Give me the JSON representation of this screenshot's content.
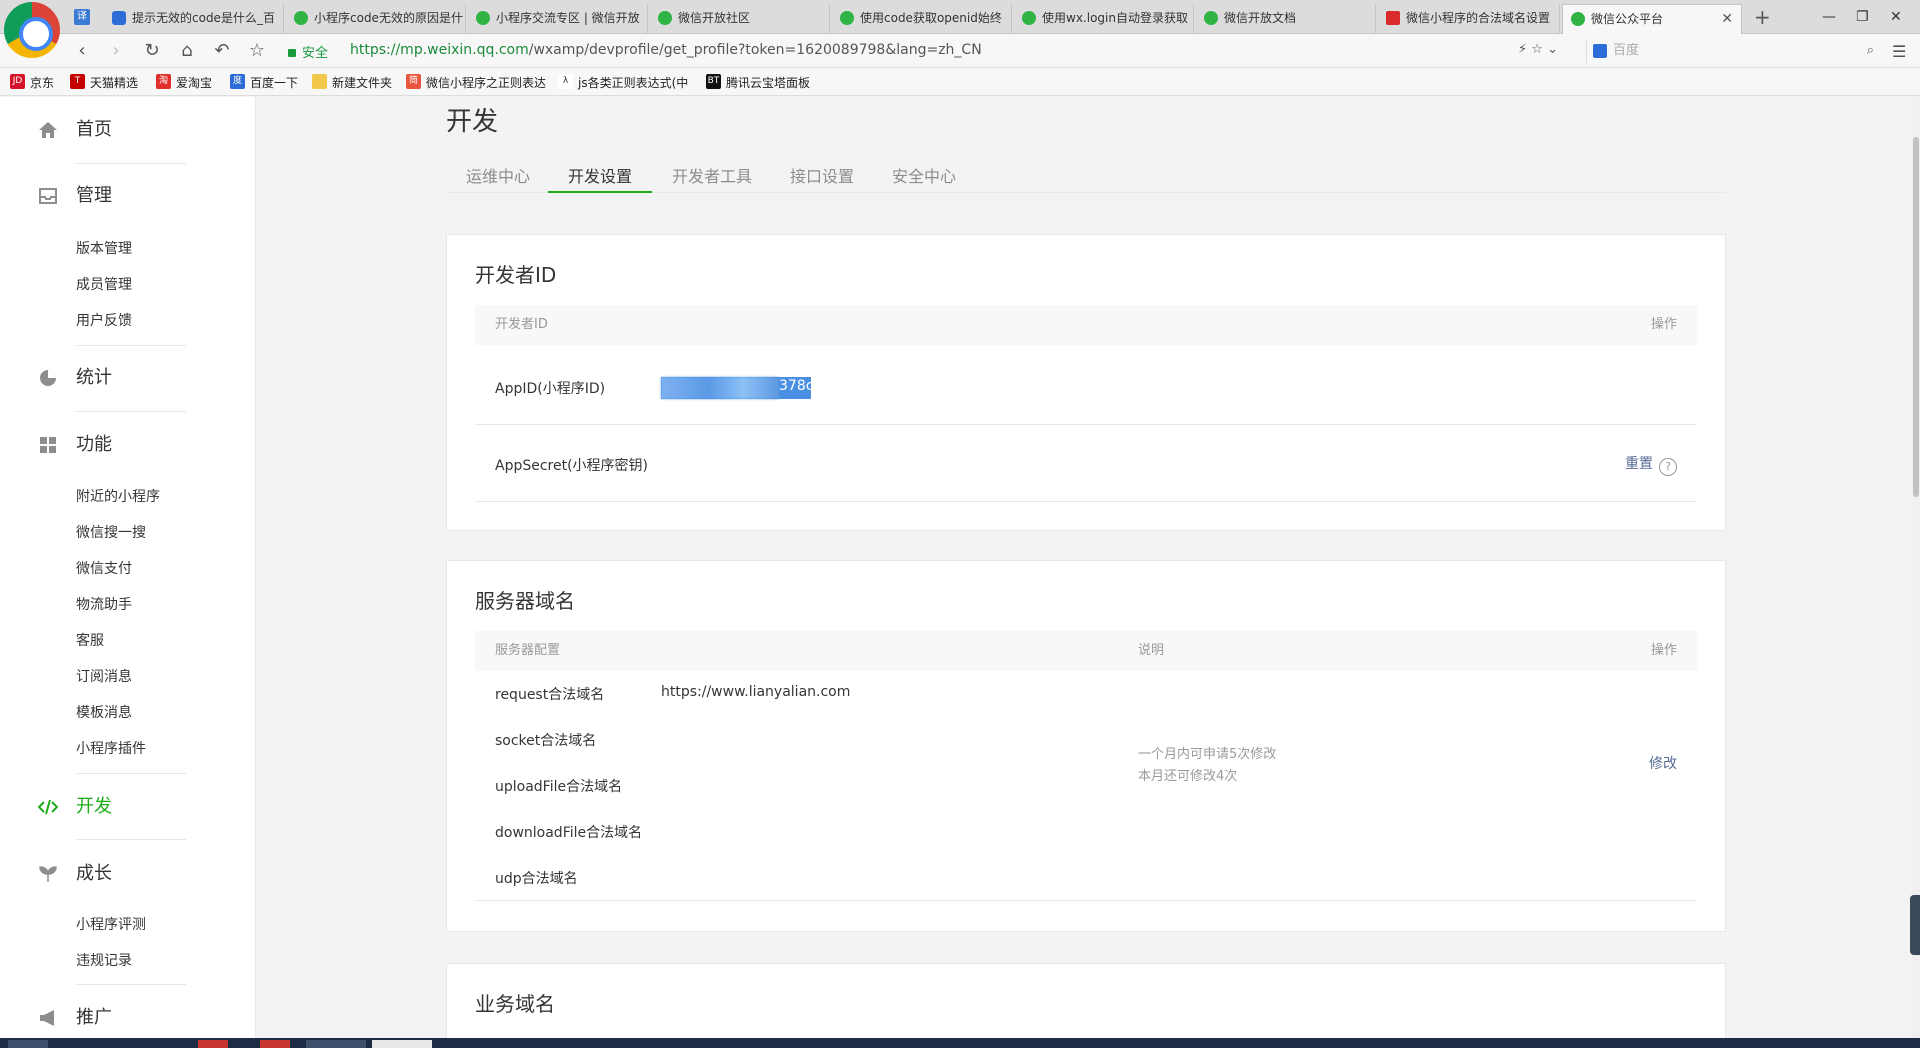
{
  "browser": {
    "tabs": [
      {
        "label": "提示无效的code是什么_百"
      },
      {
        "label": "小程序code无效的原因是什"
      },
      {
        "label": "小程序交流专区 | 微信开放"
      },
      {
        "label": "微信开放社区"
      },
      {
        "label": "使用code获取openid始终"
      },
      {
        "label": "使用wx.login自动登录获取"
      },
      {
        "label": "微信开放文档"
      },
      {
        "label": "微信小程序的合法域名设置"
      },
      {
        "label": "微信公众平台"
      }
    ],
    "pin_label": "译",
    "secure_label": "安全",
    "url_host": "https://mp.weixin.qq.com",
    "url_path": "/wxamp/devprofile/get_profile?token=1620089798&lang=zh_CN",
    "search_placeholder": "百度",
    "bookmarks": [
      {
        "label": "京东",
        "icon": "JD",
        "color": "#d4142a"
      },
      {
        "label": "天猫精选",
        "icon": "T",
        "color": "#c40000"
      },
      {
        "label": "爱淘宝",
        "icon": "淘",
        "color": "#e0302c"
      },
      {
        "label": "百度一下",
        "icon": "度",
        "color": "#2d6bd6"
      },
      {
        "label": "新建文件夹",
        "icon": "",
        "color": "#f2c94c"
      },
      {
        "label": "微信小程序之正则表达",
        "icon": "简",
        "color": "#e9553f"
      },
      {
        "label": "js各类正则表达式(中",
        "icon": "λ",
        "color": "#ffffff"
      },
      {
        "label": "腾讯云宝塔面板",
        "icon": "BT",
        "color": "#111111"
      }
    ]
  },
  "sidebar": {
    "home": "首页",
    "manage": "管理",
    "manage_items": [
      "版本管理",
      "成员管理",
      "用户反馈"
    ],
    "stats": "统计",
    "features": "功能",
    "feature_items": [
      "附近的小程序",
      "微信搜一搜",
      "微信支付",
      "物流助手",
      "客服",
      "订阅消息",
      "模板消息",
      "小程序插件"
    ],
    "dev": "开发",
    "growth": "成长",
    "growth_items": [
      "小程序评测",
      "违规记录"
    ],
    "promote": "推广"
  },
  "main": {
    "title": "开发",
    "tabs": [
      "运维中心",
      "开发设置",
      "开发者工具",
      "接口设置",
      "安全中心"
    ],
    "active_tab": "开发设置",
    "dev_id": {
      "title": "开发者ID",
      "col_left": "开发者ID",
      "col_right": "操作",
      "appid_label": "AppID(小程序ID)",
      "appid_visible": "378c",
      "secret_label": "AppSecret(小程序密钥)",
      "reset": "重置",
      "help": "?"
    },
    "server": {
      "title": "服务器域名",
      "col_config": "服务器配置",
      "col_desc": "说明",
      "col_op": "操作",
      "rows": [
        {
          "label": "request合法域名",
          "value": "https://www.lianyalian.com"
        },
        {
          "label": "socket合法域名",
          "value": ""
        },
        {
          "label": "uploadFile合法域名",
          "value": ""
        },
        {
          "label": "downloadFile合法域名",
          "value": ""
        },
        {
          "label": "udp合法域名",
          "value": ""
        }
      ],
      "desc_line1": "一个月内可申请5次修改",
      "desc_line2": "本月还可修改4次",
      "modify": "修改"
    },
    "business": {
      "title": "业务域名"
    }
  },
  "colors": {
    "accent": "#1aad19",
    "link": "#576b95"
  }
}
